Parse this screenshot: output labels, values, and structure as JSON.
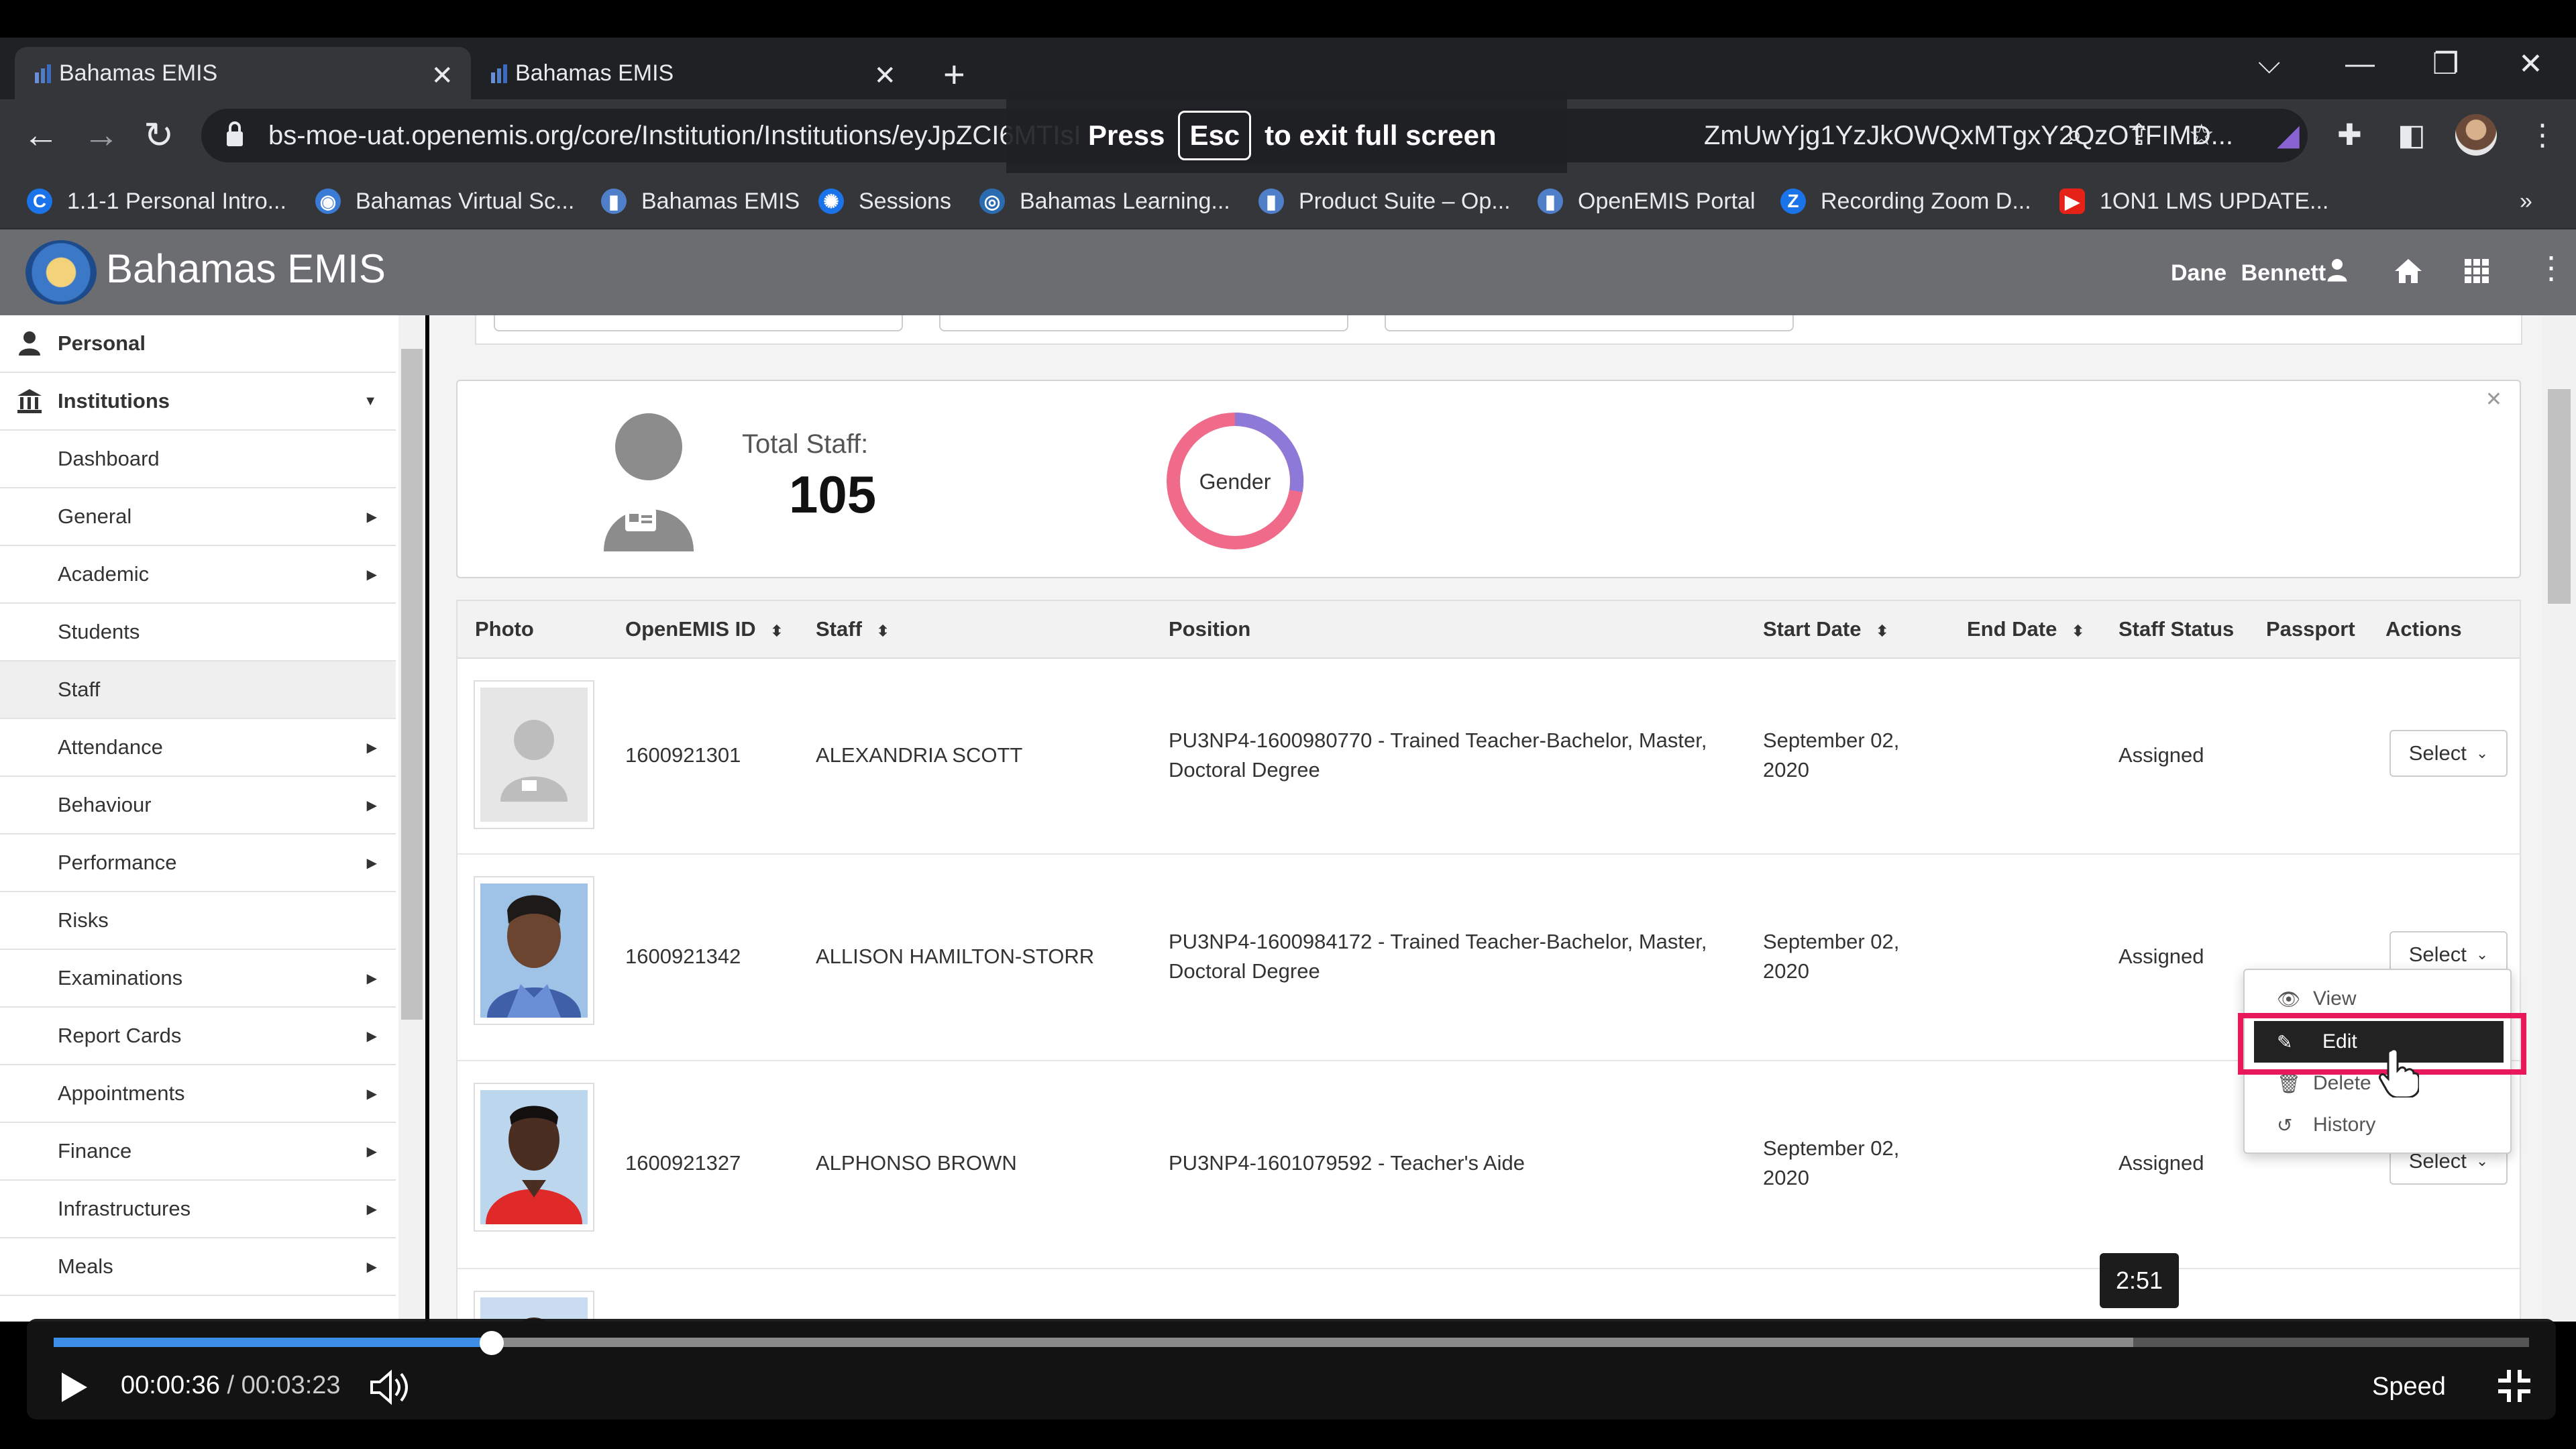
{
  "browser": {
    "tabs": [
      {
        "title": "Bahamas EMIS"
      },
      {
        "title": "Bahamas EMIS"
      }
    ],
    "url": "bs-moe-uat.openemis.org/core/Institution/Institutions/eyJpZCI6MTIsI",
    "url_tail": "ZmUwYjg1YzJkOWQxMTgxY2QzOTFIMD...",
    "fullscreen_notice": {
      "press": "Press",
      "key": "Esc",
      "suffix": "to exit full screen"
    },
    "bookmarks": [
      {
        "label": "1.1-1 Personal Intro...",
        "color": "#1a73e8",
        "glyph": "C"
      },
      {
        "label": "Bahamas Virtual Sc...",
        "color": "#3a7bd5",
        "glyph": "◉"
      },
      {
        "label": "Bahamas EMIS",
        "color": "#4f7fc9",
        "glyph": "▮"
      },
      {
        "label": "Sessions",
        "color": "#1a73e8",
        "glyph": "✺"
      },
      {
        "label": "Bahamas Learning...",
        "color": "#2b6cb0",
        "glyph": "◎"
      },
      {
        "label": "Product Suite – Op...",
        "color": "#4f7fc9",
        "glyph": "▮"
      },
      {
        "label": "OpenEMIS Portal",
        "color": "#4f7fc9",
        "glyph": "▮"
      },
      {
        "label": "Recording Zoom D...",
        "color": "#1a73e8",
        "glyph": "Z"
      },
      {
        "label": "1ON1 LMS UPDATE...",
        "color": "#e62117",
        "glyph": "▶"
      }
    ]
  },
  "app": {
    "title": "Bahamas EMIS",
    "user": {
      "first": "Dane",
      "last": "Bennett"
    }
  },
  "sidebar": {
    "items": [
      {
        "label": "Personal",
        "level": "top",
        "caret": false
      },
      {
        "label": "Institutions",
        "level": "top",
        "caret": true
      },
      {
        "label": "Dashboard",
        "level": "sub",
        "caret": false
      },
      {
        "label": "General",
        "level": "sub",
        "caret": true
      },
      {
        "label": "Academic",
        "level": "sub",
        "caret": true
      },
      {
        "label": "Students",
        "level": "sub",
        "caret": false
      },
      {
        "label": "Staff",
        "level": "sub",
        "caret": false,
        "active": true
      },
      {
        "label": "Attendance",
        "level": "sub",
        "caret": true
      },
      {
        "label": "Behaviour",
        "level": "sub",
        "caret": true
      },
      {
        "label": "Performance",
        "level": "sub",
        "caret": true
      },
      {
        "label": "Risks",
        "level": "sub",
        "caret": false
      },
      {
        "label": "Examinations",
        "level": "sub",
        "caret": true
      },
      {
        "label": "Report Cards",
        "level": "sub",
        "caret": true
      },
      {
        "label": "Appointments",
        "level": "sub",
        "caret": true
      },
      {
        "label": "Finance",
        "level": "sub",
        "caret": true
      },
      {
        "label": "Infrastructures",
        "level": "sub",
        "caret": true
      },
      {
        "label": "Meals",
        "level": "sub",
        "caret": true
      }
    ]
  },
  "summary": {
    "total_label": "Total Staff:",
    "total_value": "105",
    "chart_label": "Gender"
  },
  "table": {
    "headers": [
      "Photo",
      "OpenEMIS ID",
      "Staff",
      "Position",
      "Start Date",
      "End Date",
      "Staff Status",
      "Passport",
      "Actions"
    ],
    "rows": [
      {
        "id": "1600921301",
        "name": "ALEXANDRIA SCOTT",
        "position": "PU3NP4-1600980770 - Trained Teacher-Bachelor, Master, Doctoral Degree",
        "start_date": "September 02, 2020",
        "status": "Assigned",
        "action": "Select"
      },
      {
        "id": "1600921342",
        "name": "ALLISON HAMILTON-STORR",
        "position": "PU3NP4-1600984172 - Trained Teacher-Bachelor, Master, Doctoral Degree",
        "start_date": "September 02, 2020",
        "status": "Assigned",
        "action": "Select"
      },
      {
        "id": "1600921327",
        "name": "ALPHONSO BROWN",
        "position": "PU3NP4-1601079592 - Teacher's Aide",
        "start_date": "September 02, 2020",
        "status": "Assigned",
        "action": "Select"
      }
    ]
  },
  "dropdown": {
    "items": [
      "View",
      "Edit",
      "Delete",
      "History"
    ],
    "highlighted": "Edit"
  },
  "video": {
    "hover_time": "2:51",
    "current": "00:00:36",
    "separator": "/",
    "total": "00:03:23",
    "speed_label": "Speed",
    "progress_fraction": 0.177,
    "buffered_fraction": 0.84
  }
}
